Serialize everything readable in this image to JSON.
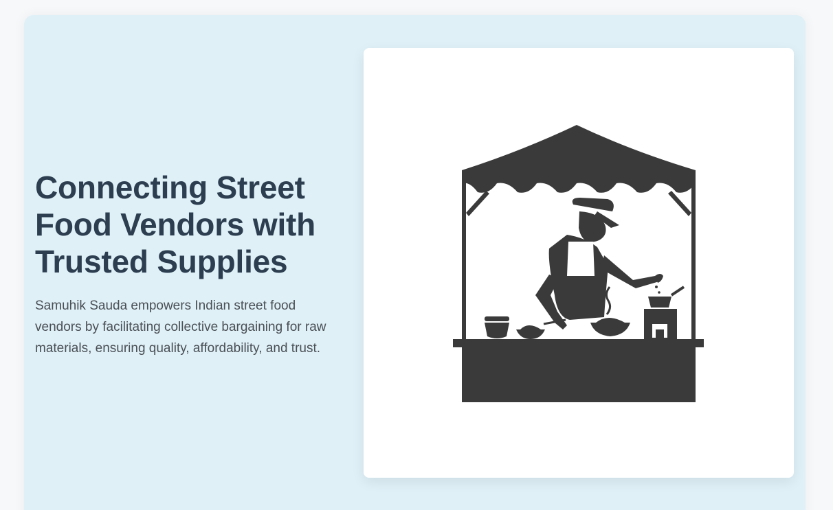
{
  "hero": {
    "title": "Connecting Street Food Vendors with Trusted Supplies",
    "description": "Samuhik Sauda empowers Indian street food vendors by facilitating collective bargaining for raw materials, ensuring quality, affordability, and trust.",
    "image_icon": "street-food-vendor-stall-illustration"
  },
  "colors": {
    "page_bg": "#f6f8fa",
    "hero_bg": "#dff0f7",
    "title": "#2c3e50",
    "text": "#4a4f55",
    "illustration": "#3a3a3a"
  }
}
